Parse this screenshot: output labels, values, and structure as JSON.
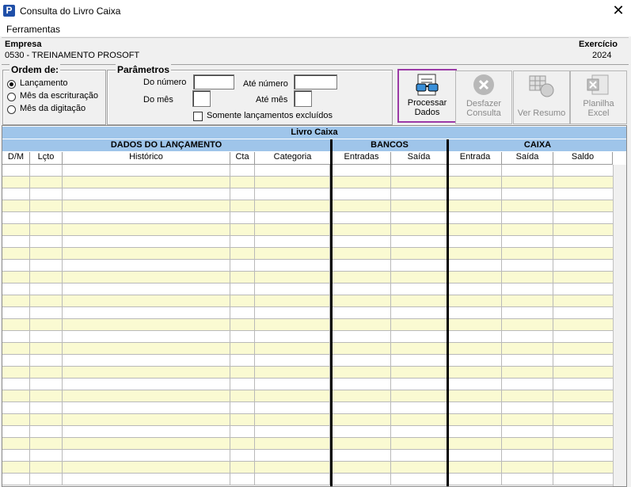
{
  "window": {
    "title": "Consulta do Livro Caixa",
    "app_icon_letter": "P",
    "close_glyph": "✕"
  },
  "menu": {
    "items": [
      "Ferramentas"
    ]
  },
  "company": {
    "label": "Empresa",
    "value": "0530 - TREINAMENTO PROSOFT",
    "year_label": "Exercício",
    "year_value": "2024"
  },
  "ordem": {
    "title": "Ordem de:",
    "options": [
      {
        "label": "Lançamento",
        "checked": true
      },
      {
        "label": "Mês da escrituração",
        "checked": false
      },
      {
        "label": "Mês da digitação",
        "checked": false
      }
    ]
  },
  "parametros": {
    "title": "Parâmetros",
    "do_numero_label": "Do número",
    "ate_numero_label": "Até número",
    "do_mes_label": "Do mês",
    "ate_mes_label": "Até mês",
    "do_numero_value": "",
    "ate_numero_value": "",
    "do_mes_value": "",
    "ate_mes_value": "",
    "somente_excluidos_label": "Somente lançamentos excluídos",
    "somente_excluidos_checked": false
  },
  "toolbar": {
    "processar": "Processar\nDados",
    "desfazer": "Desfazer\nConsulta",
    "ver_resumo": "Ver Resumo",
    "planilha": "Planilha\nExcel"
  },
  "grid": {
    "title": "Livro Caixa",
    "groups": {
      "dados": "DADOS DO LANÇAMENTO",
      "bancos": "BANCOS",
      "caixa": "CAIXA"
    },
    "columns": [
      "D/M",
      "Lçto",
      "Histórico",
      "Cta",
      "Categoria",
      "Entradas",
      "Saída",
      "Entrada",
      "Saída",
      "Saldo"
    ],
    "rows": []
  },
  "colors": {
    "header_band": "#9fc5ea",
    "row_alt": "#fafad2",
    "highlight_border": "#9b3aa6"
  }
}
